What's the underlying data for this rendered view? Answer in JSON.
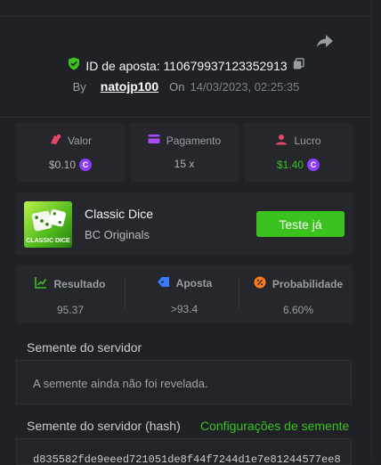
{
  "header": {
    "bet_id": "ID de aposta: 110679937123352913",
    "by_label": "By",
    "username": "natojp100",
    "on_label": "On",
    "datetime": "14/03/2023, 02:25:35"
  },
  "stats": [
    {
      "label": "Valor",
      "value": "$0.10",
      "icon": "bet-chips-icon",
      "color": "#e8456b"
    },
    {
      "label": "Pagamento",
      "value": "15 x",
      "icon": "payment-card-icon",
      "color": "#a64dff"
    },
    {
      "label": "Lucro",
      "value": "$1.40",
      "icon": "profit-user-icon",
      "color": "#e8456b",
      "value_color": "#3ac21e"
    }
  ],
  "game": {
    "name": "Classic Dice",
    "provider": "BC Originals",
    "thumb_label": "CLASSIC DICE",
    "play_button": "Teste já"
  },
  "result": [
    {
      "label": "Resultado",
      "value": "95.37",
      "icon": "result-chart-icon",
      "color": "#3ac21e"
    },
    {
      "label": "Aposta",
      "value": ">93.4",
      "icon": "bet-tag-icon",
      "color": "#3a7bff"
    },
    {
      "label": "Probabilidade",
      "value": "6.60%",
      "icon": "percent-icon",
      "color": "#ff7a1a"
    }
  ],
  "seed": {
    "server_seed_label": "Semente do servidor",
    "server_seed_text": "A semente ainda não foi revelada.",
    "hash_label": "Semente do servidor (hash)",
    "config_link": "Configurações de semente",
    "hash_value": "d835582fde9eeed721051de8f44f7244d1e7e81244577ee8"
  },
  "coin_symbol": "C"
}
